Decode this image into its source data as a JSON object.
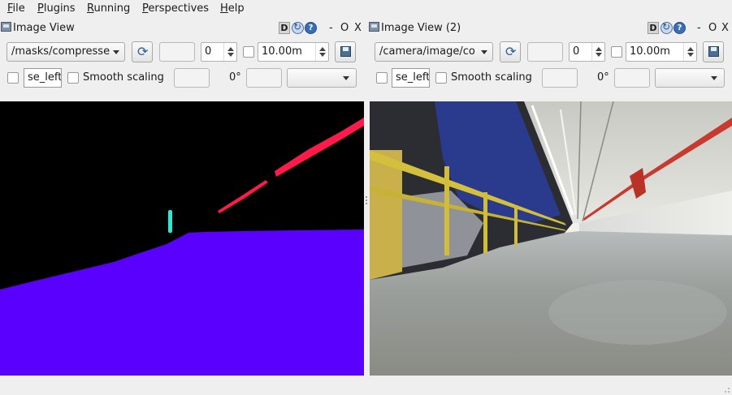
{
  "menubar": {
    "items": [
      {
        "mnemonic": "F",
        "rest": "ile"
      },
      {
        "mnemonic": "P",
        "rest": "lugins"
      },
      {
        "mnemonic": "R",
        "rest": "unning"
      },
      {
        "mnemonic": "P",
        "rest": "erspectives"
      },
      {
        "mnemonic": "H",
        "rest": "elp"
      }
    ]
  },
  "left_view": {
    "title": "Image View",
    "dock_d": "D",
    "dock_help": "?",
    "dock_minus": "-",
    "dock_float": "O",
    "dock_close": "X",
    "topic": "/masks/compresse",
    "spin_value": "0",
    "distance": "10.00m",
    "mouse_topic": "se_left",
    "smooth_scaling": "Smooth scaling",
    "rotation": "0°"
  },
  "right_view": {
    "title": "Image View (2)",
    "dock_d": "D",
    "dock_help": "?",
    "dock_minus": "-",
    "dock_float": "O",
    "dock_close": "X",
    "topic": "/camera/image/co",
    "spin_value": "0",
    "distance": "10.00m",
    "mouse_topic": "se_left",
    "smooth_scaling": "Smooth scaling",
    "rotation": "0°"
  },
  "colors": {
    "mask_floor": "#5a00ff",
    "mask_pipe": "#ff1a4a",
    "mask_marker": "#2ee8d6",
    "mask_background": "#000000"
  }
}
